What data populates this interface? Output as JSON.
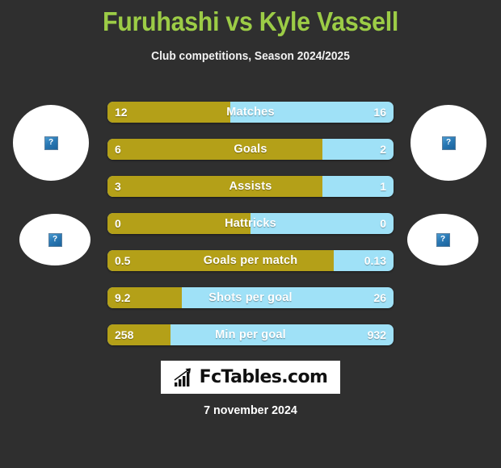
{
  "header": {
    "title": "Furuhashi vs Kyle Vassell",
    "subtitle": "Club competitions, Season 2024/2025",
    "title_color": "#9ccc46"
  },
  "avatars": {
    "placeholder_glyph": "?",
    "left_top_name": "player-left-photo",
    "left_bottom_name": "club-left-logo",
    "right_top_name": "player-right-photo",
    "right_bottom_name": "club-right-logo"
  },
  "chart_data": {
    "type": "bar",
    "title": "Furuhashi vs Kyle Vassell",
    "subtitle": "Club competitions, Season 2024/2025",
    "orientation": "horizontal-diverging",
    "legend_position": "none",
    "grid": false,
    "series": [
      {
        "name": "Furuhashi",
        "color": "#b4a018",
        "side": "left"
      },
      {
        "name": "Kyle Vassell",
        "color": "#9fe1f7",
        "side": "right"
      }
    ],
    "categories": [
      "Matches",
      "Goals",
      "Assists",
      "Hattricks",
      "Goals per match",
      "Shots per goal",
      "Min per goal"
    ],
    "rows": [
      {
        "label": "Matches",
        "left": "12",
        "right": "16",
        "left_pct": 43
      },
      {
        "label": "Goals",
        "left": "6",
        "right": "2",
        "left_pct": 75
      },
      {
        "label": "Assists",
        "left": "3",
        "right": "1",
        "left_pct": 75
      },
      {
        "label": "Hattricks",
        "left": "0",
        "right": "0",
        "left_pct": 50
      },
      {
        "label": "Goals per match",
        "left": "0.5",
        "right": "0.13",
        "left_pct": 79
      },
      {
        "label": "Shots per goal",
        "left": "9.2",
        "right": "26",
        "left_pct": 26
      },
      {
        "label": "Min per goal",
        "left": "258",
        "right": "932",
        "left_pct": 22
      }
    ]
  },
  "footer": {
    "logo_text": "FcTables.com",
    "logo_icon": "bar-chart-growth-icon",
    "date": "7 november 2024"
  }
}
